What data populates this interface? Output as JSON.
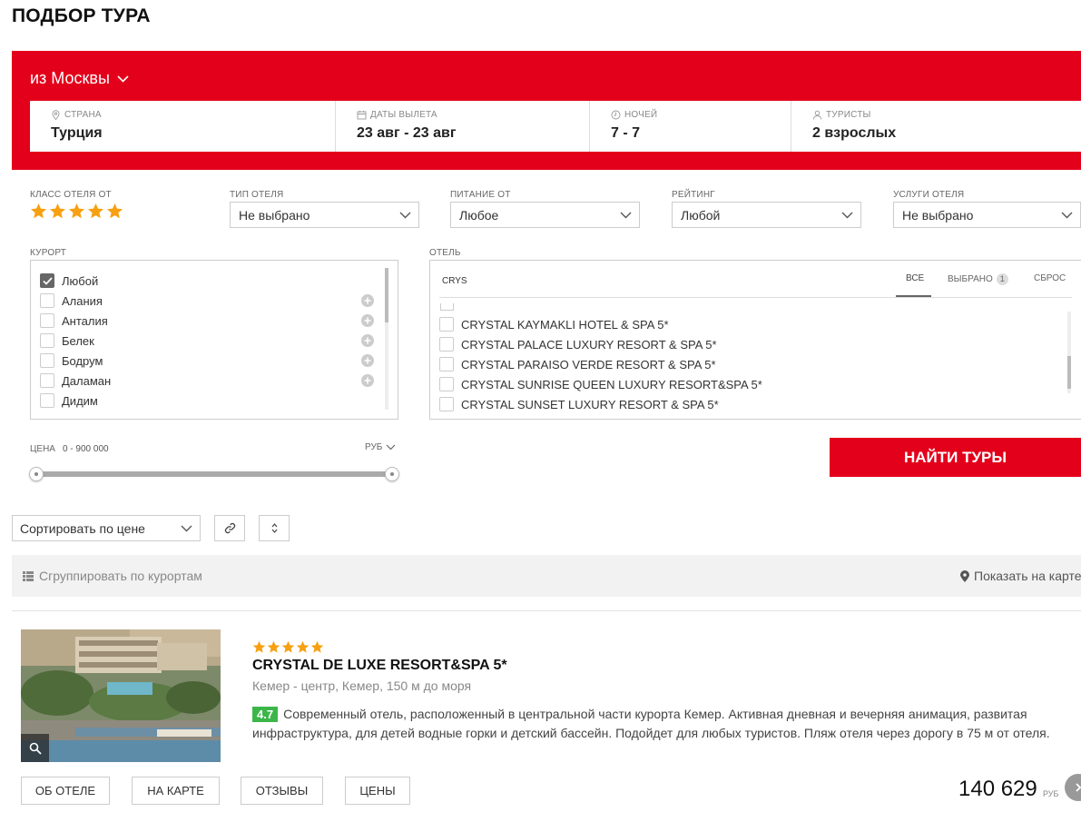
{
  "page": {
    "title": "ПОДБОР ТУРА"
  },
  "search": {
    "departure": "из Москвы",
    "fields": [
      {
        "label": "СТРАНА",
        "value": "Турция",
        "icon": "pin-icon"
      },
      {
        "label": "ДАТЫ ВЫЛЕТА",
        "value": "23 авг - 23 авг",
        "icon": "calendar-icon"
      },
      {
        "label": "НОЧЕЙ",
        "value": "7 - 7",
        "icon": "clock-icon"
      },
      {
        "label": "ТУРИСТЫ",
        "value": "2 взрослых",
        "icon": "user-icon"
      }
    ],
    "brand_color": "#e3001b"
  },
  "filters": {
    "hotel_class": {
      "label": "КЛАСС ОТЕЛЯ ОТ",
      "stars": 5
    },
    "hotel_type": {
      "label": "ТИП ОТЕЛЯ",
      "value": "Не выбрано"
    },
    "meal": {
      "label": "ПИТАНИЕ ОТ",
      "value": "Любое"
    },
    "rating": {
      "label": "РЕЙТИНГ",
      "value": "Любой"
    },
    "services": {
      "label": "УСЛУГИ ОТЕЛЯ",
      "value": "Не выбрано"
    }
  },
  "resorts": {
    "label": "КУРОРТ",
    "items": [
      {
        "name": "Любой",
        "checked": true,
        "expandable": false
      },
      {
        "name": "Алания",
        "checked": false,
        "expandable": true
      },
      {
        "name": "Анталия",
        "checked": false,
        "expandable": true
      },
      {
        "name": "Белек",
        "checked": false,
        "expandable": true
      },
      {
        "name": "Бодрум",
        "checked": false,
        "expandable": true
      },
      {
        "name": "Даламан",
        "checked": false,
        "expandable": true
      },
      {
        "name": "Дидим",
        "checked": false,
        "expandable": false
      }
    ]
  },
  "hotels": {
    "label": "ОТЕЛЬ",
    "search_value": "CRYS",
    "tabs": {
      "all": "ВСЕ",
      "selected": "ВЫБРАНО",
      "selected_count": "1",
      "reset": "СБРОС"
    },
    "items": [
      "CRYSTAL KAYMAKLI HOTEL & SPA 5*",
      "CRYSTAL PALACE LUXURY RESORT & SPA 5*",
      "CRYSTAL PARAISO VERDE RESORT & SPA 5*",
      "CRYSTAL SUNRISE QUEEN LUXURY RESORT&SPA 5*",
      "CRYSTAL SUNSET LUXURY RESORT & SPA 5*"
    ]
  },
  "price": {
    "label": "ЦЕНА",
    "range": "0 -  900 000",
    "currency": "РУБ",
    "min": 0,
    "max": 900000
  },
  "find_button": "НАЙТИ ТУРЫ",
  "toolbar": {
    "sort": "Сортировать по цене",
    "group": "Сгруппировать по курортам",
    "map": "Показать на карте"
  },
  "result": {
    "stars": 5,
    "name": "CRYSTAL DE LUXE RESORT&SPA 5*",
    "location": "Кемер - центр, Кемер, 150 м до моря",
    "rating": "4.7",
    "description": "Современный отель, расположенный в центральной части курорта Кемер. Активная дневная и вечерняя анимация, развитая инфраструктура, для детей водные горки и детский бассейн. Подойдет для любых туристов. Пляж отеля через дорогу в 75 м от отеля.",
    "buttons": [
      "ОБ ОТЕЛЕ",
      "НА КАРТЕ",
      "ОТЗЫВЫ",
      "ЦЕНЫ"
    ],
    "price": "140 629",
    "currency": "РУБ"
  }
}
